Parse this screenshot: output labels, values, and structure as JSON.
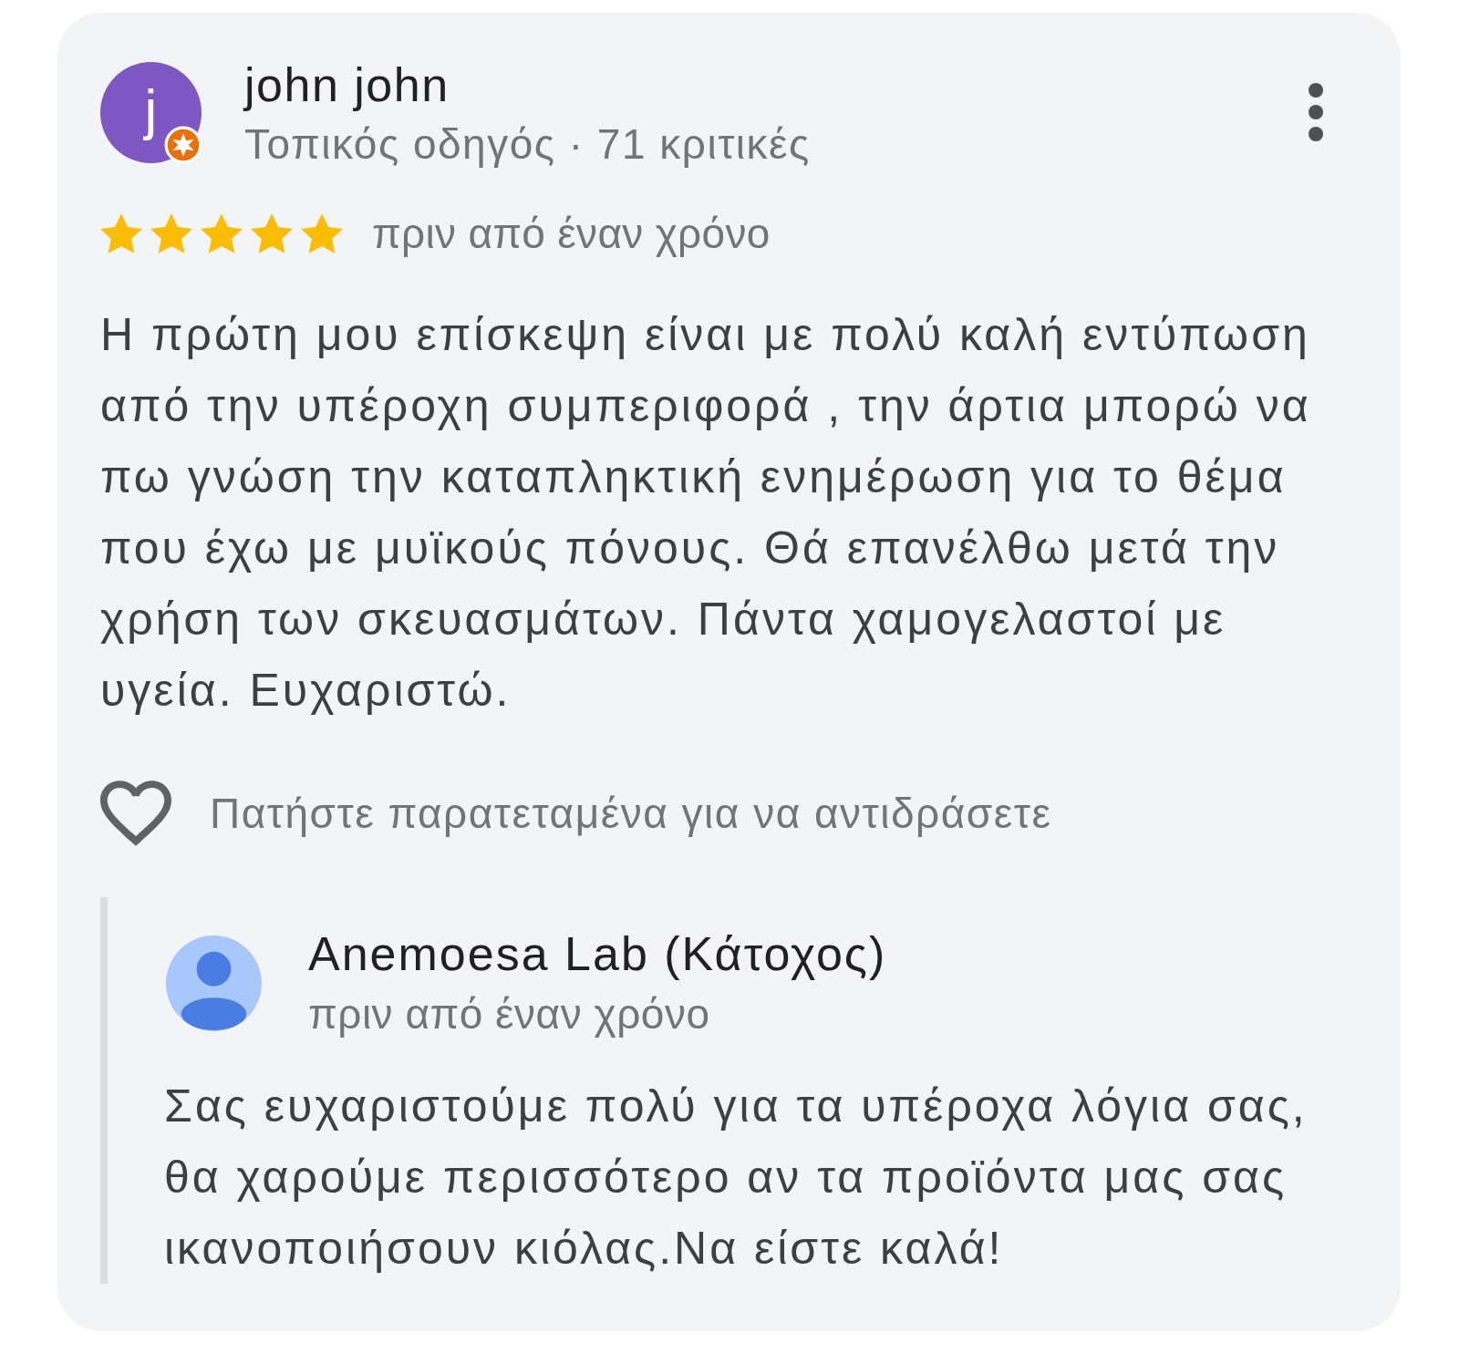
{
  "review": {
    "avatar_initial": "j",
    "author": "john john",
    "author_meta": "Τοπικός οδηγός · 71 κριτικές",
    "stars": 5,
    "time": "πριν από έναν χρόνο",
    "text": "Η πρώτη μου επίσκεψη είναι με πολύ καλή εντύπωση από την υπέροχη συμπεριφορά , την άρτια μπορώ να πω γνώση την καταπληκτική ενημέρωση για το θέμα που έχω με μυϊκούς πόνους. Θά επανέλθω μετά την χρήση των σκευασμάτων. Πάντα χαμογελαστοί με υγεία. Ευχαριστώ.",
    "reaction_hint": "Πατήστε παρατεταμένα για να αντιδράσετε"
  },
  "reply": {
    "author": "Anemoesa Lab (Κάτοχος)",
    "time": "πριν από έναν χρόνο",
    "text": "Σας ευχαριστούμε πολύ για τα υπέροχα λόγια σας, θα χαρούμε περισσότερο αν τα προϊόντα μας σας ικανοποιήσουν κιόλας.Να είστε καλά!"
  }
}
